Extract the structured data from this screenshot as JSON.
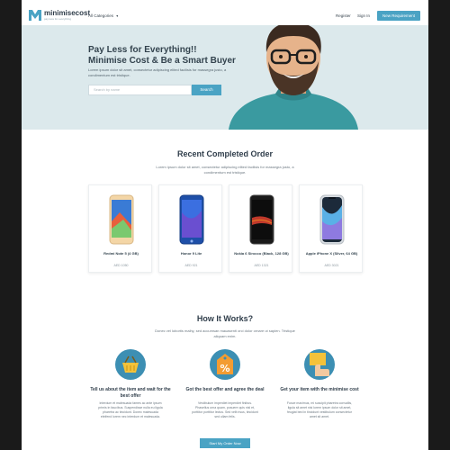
{
  "header": {
    "brand": "minimisecost",
    "tagline": "pay less for everything",
    "categories_label": "All Categories",
    "register_label": "Register",
    "signin_label": "Sign In",
    "new_requirement_label": "New Requirement"
  },
  "hero": {
    "title_line1": "Pay Less for Everything!!",
    "title_line2": "Minimise Cost & Be a Smart Buyer",
    "subtitle": "Lorem ipsum dolor sit amet, consectetur adipiscing elited facilisis for massegra justo, a condimentum est tristique.",
    "search_placeholder": "Search by name",
    "search_button": "Search"
  },
  "recent": {
    "title": "Recent Completed Order",
    "subtitle": "Lorem ipsum dolor sit amet, consectetur adipiscing elited facilisis for massegra justo, a condimentum est tristique.",
    "cards": [
      {
        "name": "Redmi Note 5 (4 GB)",
        "price": "AED 1050"
      },
      {
        "name": "Honor 9 Lite",
        "price": "AED 921"
      },
      {
        "name": "Nokia 6 Sirocco (Black, 128 GB)",
        "price": "AED 1321"
      },
      {
        "name": "Apple iPhone X (Silver, 64 GB)",
        "price": "AED 3021"
      }
    ]
  },
  "how": {
    "title": "How It Works?",
    "subtitle": "Donec vel lobortis malhy, sed accumsan mauasenti orci dolor ornare ut sapien. Tristique aliquam enim.",
    "steps": [
      {
        "title": "Tell us about the item and wait for the best offer",
        "desc": "Interdum et malesuada fames ac ante ipsum primis in faucibus. Suspendisse nulla eu ligula pharetra ac tincidunt. Donec malesuada eleifend lorem nec interdum et malesuada."
      },
      {
        "title": "Got the best offer and agree the deal",
        "desc": "Vestibulum imperdiet imperdiet finibus. Phasellus urna quam, posuere quis nisl et, porttitor porttitor lectus. Sed velit risus, tincidunt sed ullam felis."
      },
      {
        "title": "Get your item with the minimise cost",
        "desc": "Fusce maximus, mi suscipit pharetra convallis, ligula sit amet nisi lorem ipsum dolor sit amet, feugiat bed in tincidunt vestibulum consectetur amet sit amet."
      }
    ],
    "start_button": "Start My Order Now"
  },
  "colors": {
    "accent": "#4aa3c4",
    "hero_bg": "#dce9ec",
    "heading": "#2f3d4a"
  }
}
